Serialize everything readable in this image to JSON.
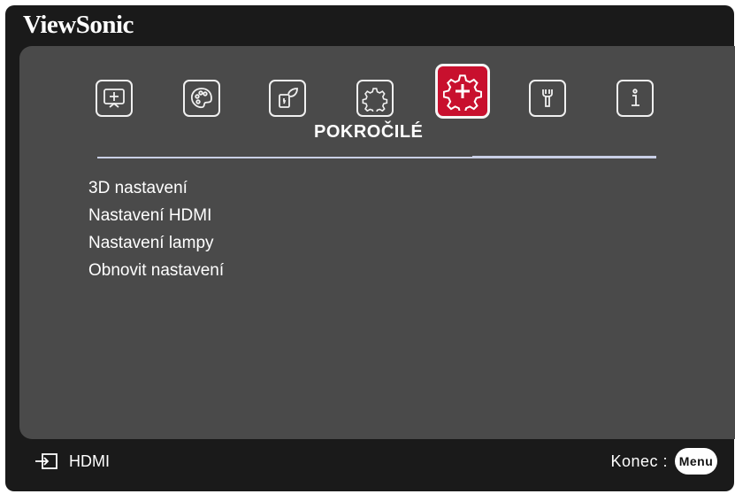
{
  "brand": "ViewSonic",
  "menu": {
    "title": "POKROČILÉ",
    "tabs": [
      {
        "icon": "display-icon"
      },
      {
        "icon": "picture-palette-icon"
      },
      {
        "icon": "power-eco-icon"
      },
      {
        "icon": "basic-gear-icon"
      },
      {
        "icon": "advanced-gear-plus-icon",
        "selected": true
      },
      {
        "icon": "system-wrench-icon"
      },
      {
        "icon": "information-icon"
      }
    ],
    "items": [
      "3D nastavení",
      "Nastavení HDMI",
      "Nastavení lampy",
      "Obnovit nastavení"
    ]
  },
  "footer": {
    "source": "HDMI",
    "exit_label": "Konec :",
    "menu_button": "Menu"
  },
  "colors": {
    "background": "#1a1a1a",
    "panel": "#4a4a4a",
    "selected_tab": "#c8102e",
    "text": "#ffffff"
  }
}
